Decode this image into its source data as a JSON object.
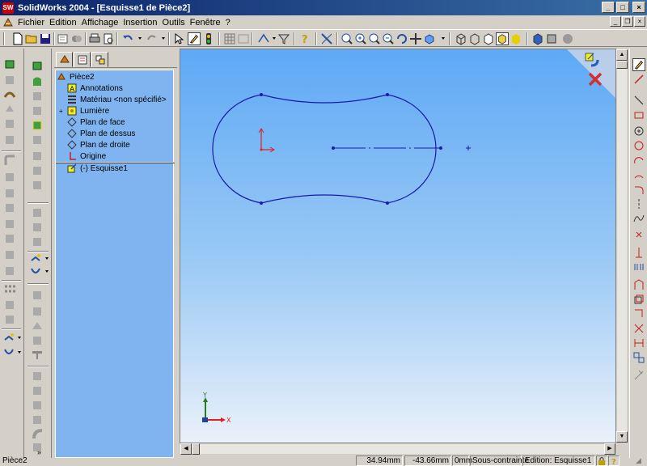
{
  "window": {
    "app_icon": "solidworks-logo-icon",
    "app_icon_text": "SW",
    "title": "SolidWorks 2004 - [Esquisse1 de Pièce2]",
    "minimize": "_",
    "maximize": "□",
    "close": "×"
  },
  "menu": {
    "items": [
      "Fichier",
      "Edition",
      "Affichage",
      "Insertion",
      "Outils",
      "Fenêtre",
      "?"
    ]
  },
  "feature_manager": {
    "tabs": [
      "feature-tree-tab",
      "property-tab",
      "configuration-tab"
    ],
    "tree": {
      "root": "Pièce2",
      "items": [
        {
          "label": "Annotations",
          "icon": "annotations-icon"
        },
        {
          "label": "Matériau <non spécifié>",
          "icon": "material-icon"
        },
        {
          "label": "Lumière",
          "icon": "light-icon",
          "expand": "+"
        },
        {
          "label": "Plan de face",
          "icon": "plane-icon"
        },
        {
          "label": "Plan de dessus",
          "icon": "plane-icon"
        },
        {
          "label": "Plan de droite",
          "icon": "plane-icon"
        },
        {
          "label": "Origine",
          "icon": "origin-icon"
        }
      ],
      "sketch": {
        "label": "(-) Esquisse1",
        "icon": "sketch-icon"
      }
    }
  },
  "status": {
    "left": "Pièce2",
    "x": "34.94mm",
    "y": "-43.66mm",
    "z": "0mm",
    "state": "Sous-contrainte",
    "edit": "Edition: Esquisse1"
  },
  "colors": {
    "sketch_line": "#1a1aa8",
    "tree_bg": "#7fb4f0",
    "viewport_top": "#5ea9f5",
    "origin_red": "#e02020"
  }
}
